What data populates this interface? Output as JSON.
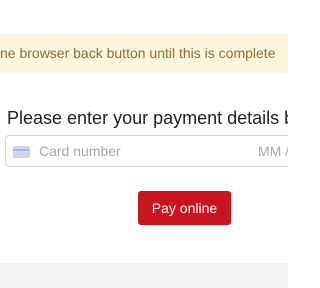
{
  "notice": {
    "text": "ne browser back button until this is complete"
  },
  "payment": {
    "heading": "Please enter your payment details b",
    "card_number_placeholder": "Card number",
    "expiry_placeholder": "MM /",
    "card_icon": "credit-card-icon"
  },
  "actions": {
    "pay_label": "Pay online"
  },
  "colors": {
    "notice_background": "#fcf6dc",
    "notice_text": "#8a6d3b",
    "button_background": "#c9151f",
    "button_text": "#ffffff"
  }
}
